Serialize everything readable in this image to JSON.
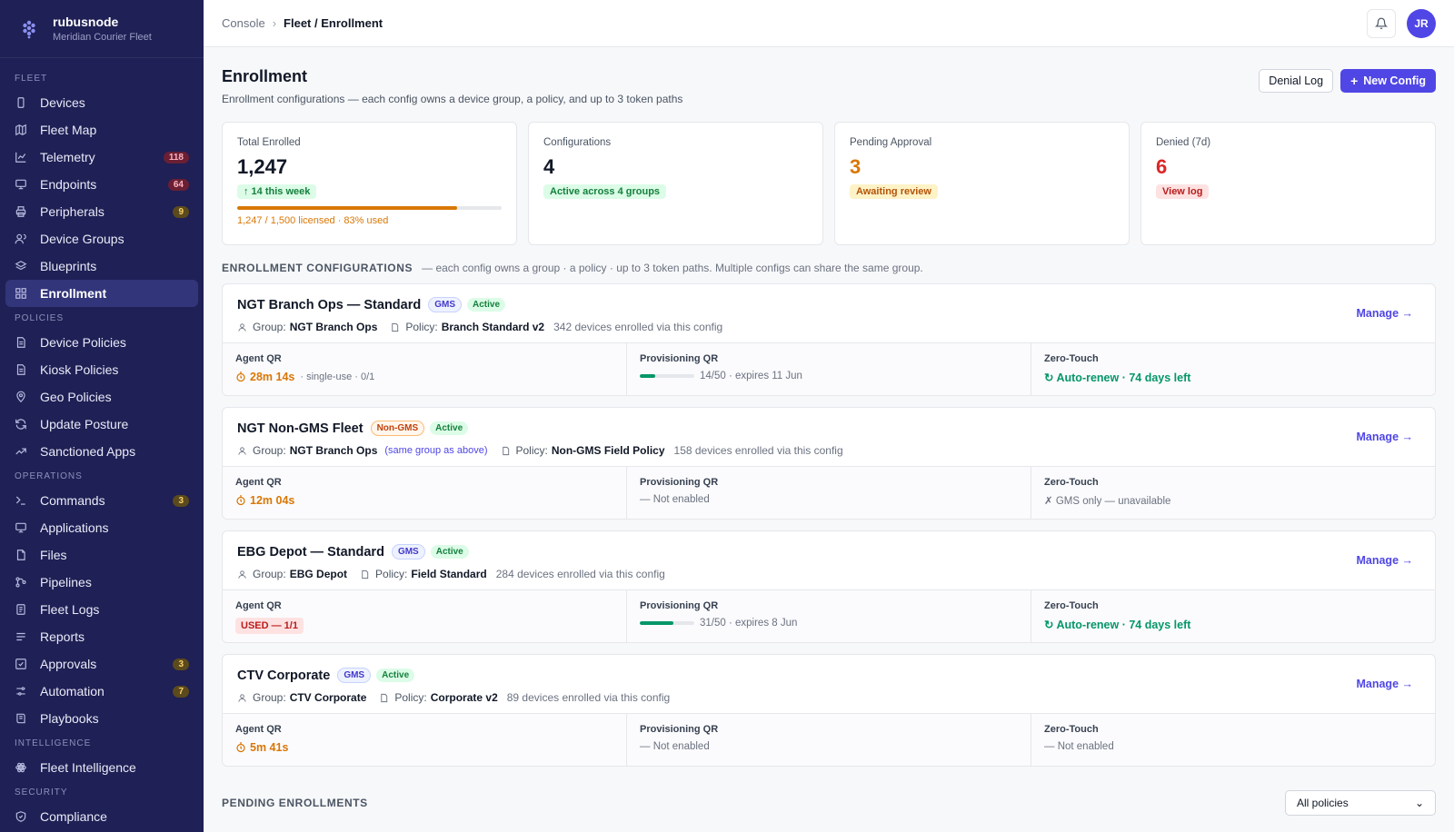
{
  "brand": {
    "name": "rubusnode",
    "org": "Meridian Courier Fleet"
  },
  "sidebar": {
    "sections": [
      {
        "title": "FLEET",
        "items": [
          {
            "label": "Devices",
            "icon": "phone-icon"
          },
          {
            "label": "Fleet Map",
            "icon": "map-icon"
          },
          {
            "label": "Telemetry",
            "icon": "chart-icon",
            "badge": "118",
            "badge_tone": "red"
          },
          {
            "label": "Endpoints",
            "icon": "monitor-icon",
            "badge": "64",
            "badge_tone": "red"
          },
          {
            "label": "Peripherals",
            "icon": "printer-icon",
            "badge": "9",
            "badge_tone": "amber"
          },
          {
            "label": "Device Groups",
            "icon": "users-icon"
          },
          {
            "label": "Blueprints",
            "icon": "layers-icon"
          },
          {
            "label": "Enrollment",
            "icon": "grid-icon",
            "active": true
          }
        ]
      },
      {
        "title": "POLICIES",
        "items": [
          {
            "label": "Device Policies",
            "icon": "doc-icon"
          },
          {
            "label": "Kiosk Policies",
            "icon": "doc-icon"
          },
          {
            "label": "Geo Policies",
            "icon": "pin-icon"
          },
          {
            "label": "Update Posture",
            "icon": "refresh-icon"
          },
          {
            "label": "Sanctioned Apps",
            "icon": "trend-icon"
          }
        ]
      },
      {
        "title": "OPERATIONS",
        "items": [
          {
            "label": "Commands",
            "icon": "terminal-icon",
            "badge": "3",
            "badge_tone": "amber"
          },
          {
            "label": "Applications",
            "icon": "monitor-icon"
          },
          {
            "label": "Files",
            "icon": "file-icon"
          },
          {
            "label": "Pipelines",
            "icon": "pipeline-icon"
          },
          {
            "label": "Fleet Logs",
            "icon": "log-icon"
          },
          {
            "label": "Reports",
            "icon": "list-icon"
          },
          {
            "label": "Approvals",
            "icon": "check-icon",
            "badge": "3",
            "badge_tone": "amber"
          },
          {
            "label": "Automation",
            "icon": "sliders-icon",
            "badge": "7",
            "badge_tone": "amber"
          },
          {
            "label": "Playbooks",
            "icon": "book-icon"
          }
        ]
      },
      {
        "title": "INTELLIGENCE",
        "items": [
          {
            "label": "Fleet Intelligence",
            "icon": "atom-icon"
          }
        ]
      },
      {
        "title": "SECURITY",
        "items": [
          {
            "label": "Compliance",
            "icon": "shield-icon"
          }
        ]
      }
    ]
  },
  "topbar": {
    "crumb_root": "Console",
    "crumb_sep": "›",
    "crumb_current": "Fleet / Enrollment",
    "avatar": "JR"
  },
  "page": {
    "title": "Enrollment",
    "description": "Enrollment configurations — each config owns a device group, a policy, and up to 3 token paths",
    "denial_log_label": "Denial Log",
    "new_config_label": "New Config"
  },
  "stats": {
    "total": {
      "label": "Total Enrolled",
      "value": "1,247",
      "pill": "↑ 14 this week",
      "progress": 0.83,
      "foot": "1,247 / 1,500 licensed · 83% used"
    },
    "configs": {
      "label": "Configurations",
      "value": "4",
      "pill": "Active across 4 groups"
    },
    "pending": {
      "label": "Pending Approval",
      "value": "3",
      "pill": "Awaiting review"
    },
    "denied": {
      "label": "Denied (7d)",
      "value": "6",
      "pill": "View log"
    }
  },
  "configs_section": {
    "title": "ENROLLMENT CONFIGURATIONS",
    "note": "— each config owns a group · a policy · up to 3 token paths. Multiple configs can share the same group."
  },
  "labels": {
    "group": "Group:",
    "policy": "Policy:",
    "manage": "Manage →",
    "agent_qr": "Agent QR",
    "prov_qr": "Provisioning QR",
    "zero_touch": "Zero-Touch"
  },
  "configs": [
    {
      "name": "NGT Branch Ops — Standard",
      "type_tag": "GMS",
      "status": "Active",
      "group": "NGT Branch Ops",
      "policy": "Branch Standard v2",
      "enrolled": "342 devices enrolled via this config",
      "agent_timer": "28m 14s",
      "agent_note": "· single-use · 0/1",
      "prov_progress": 0.28,
      "prov_text": "14/50 · expires 11 Jun",
      "zero_touch": "↻ Auto-renew · 74 days left"
    },
    {
      "name": "NGT Non-GMS Fleet",
      "type_tag": "Non-GMS",
      "status": "Active",
      "group": "NGT Branch Ops",
      "same_group_note": "(same group as above)",
      "policy": "Non-GMS Field Policy",
      "enrolled": "158 devices enrolled via this config",
      "agent_timer": "12m 04s",
      "prov_text": "— Not enabled",
      "zero_touch": "✗ GMS only — unavailable"
    },
    {
      "name": "EBG Depot — Standard",
      "type_tag": "GMS",
      "status": "Active",
      "group": "EBG Depot",
      "policy": "Field Standard",
      "enrolled": "284 devices enrolled via this config",
      "agent_used": "USED — 1/1",
      "prov_progress": 0.62,
      "prov_text": "31/50 · expires 8 Jun",
      "zero_touch": "↻ Auto-renew · 74 days left"
    },
    {
      "name": "CTV Corporate",
      "type_tag": "GMS",
      "status": "Active",
      "group": "CTV Corporate",
      "policy": "Corporate v2",
      "enrolled": "89 devices enrolled via this config",
      "agent_timer": "5m 41s",
      "prov_text": "— Not enabled",
      "zero_touch": "— Not enabled"
    }
  ],
  "pending": {
    "title": "PENDING ENROLLMENTS",
    "filter_value": "All policies"
  },
  "colors": {
    "sidebar_bg": "#1f2055",
    "accent": "#4f46e5",
    "amber": "#d97706",
    "red": "#dc2626",
    "green": "#059669"
  }
}
